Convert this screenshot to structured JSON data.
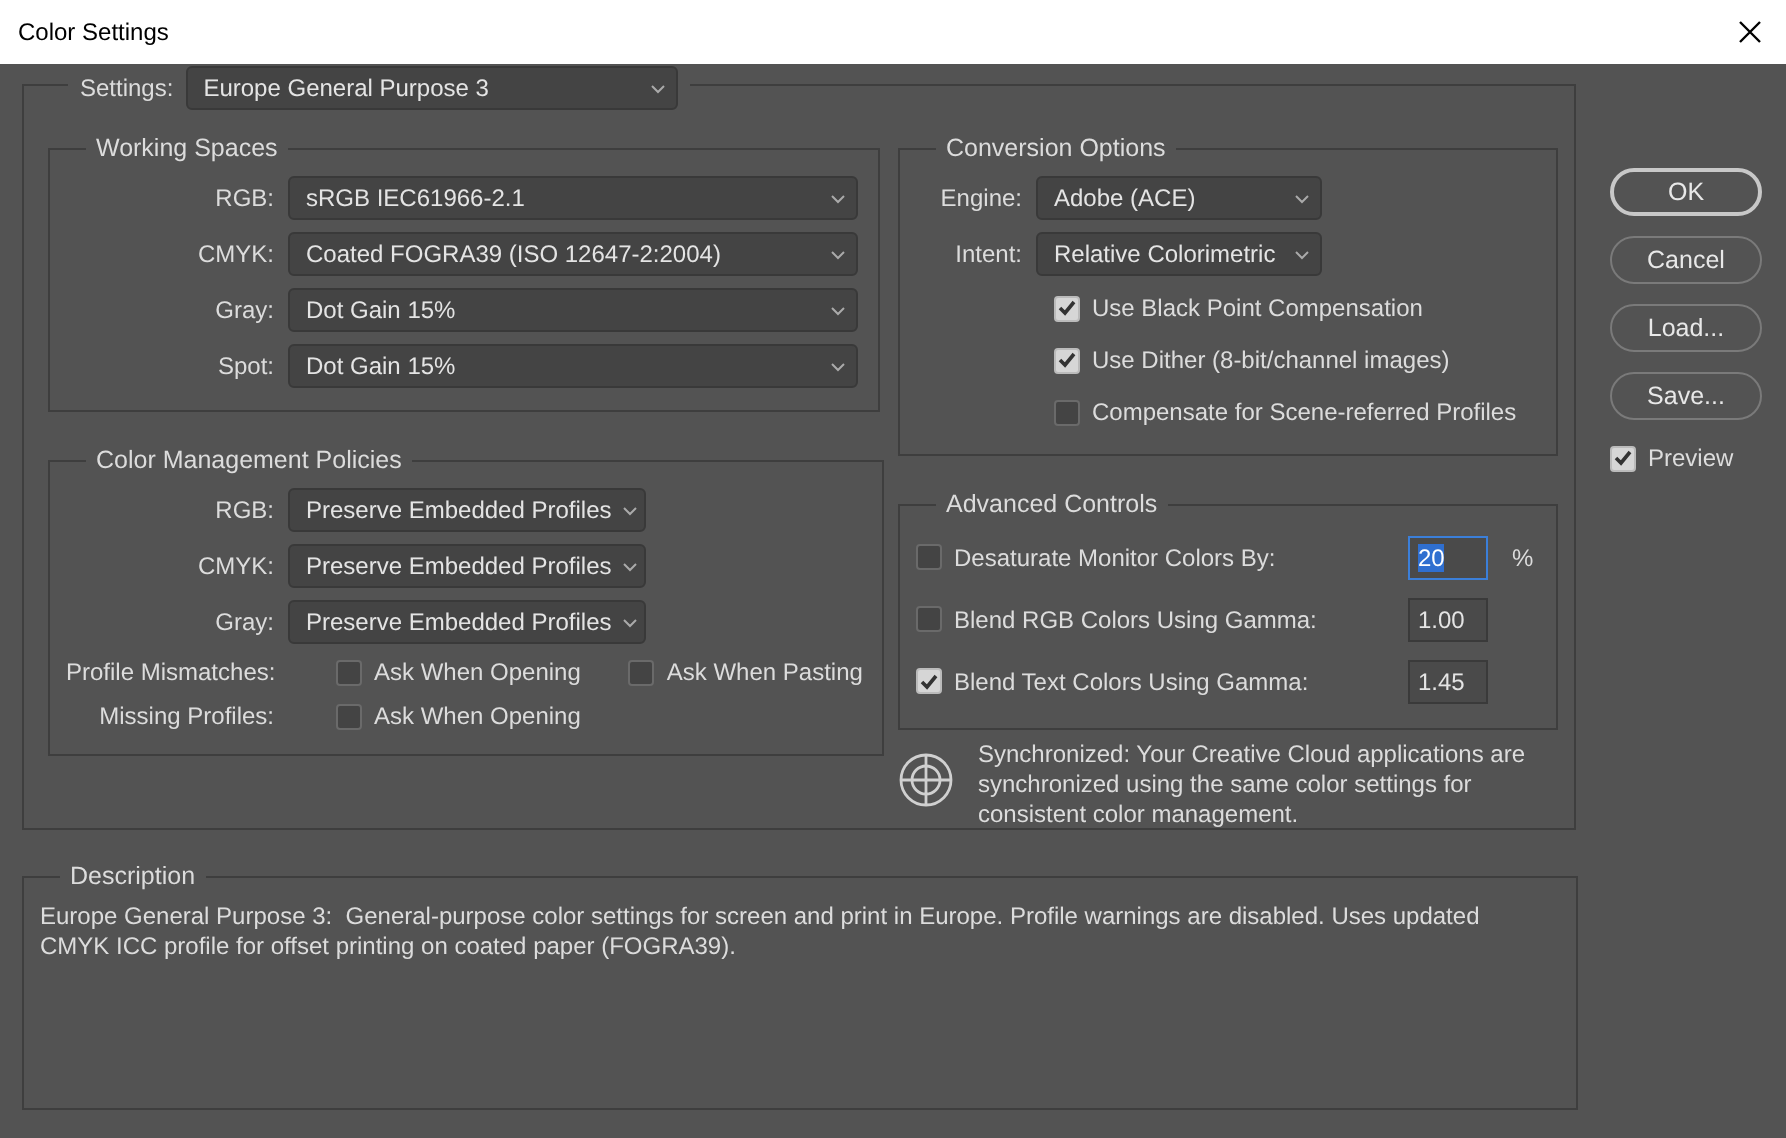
{
  "window": {
    "title": "Color Settings"
  },
  "settings": {
    "label": "Settings:",
    "value": "Europe General Purpose 3"
  },
  "working_spaces": {
    "title": "Working Spaces",
    "rows": [
      {
        "label": "RGB:",
        "value": "sRGB IEC61966-2.1"
      },
      {
        "label": "CMYK:",
        "value": "Coated FOGRA39 (ISO 12647-2:2004)"
      },
      {
        "label": "Gray:",
        "value": "Dot Gain 15%"
      },
      {
        "label": "Spot:",
        "value": "Dot Gain 15%"
      }
    ]
  },
  "policies": {
    "title": "Color Management Policies",
    "rows": [
      {
        "label": "RGB:",
        "value": "Preserve Embedded Profiles"
      },
      {
        "label": "CMYK:",
        "value": "Preserve Embedded Profiles"
      },
      {
        "label": "Gray:",
        "value": "Preserve Embedded Profiles"
      }
    ],
    "checks": [
      {
        "label": "Profile Mismatches:",
        "options": [
          {
            "label": "Ask When Opening",
            "checked": false
          },
          {
            "label": "Ask When Pasting",
            "checked": false
          }
        ]
      },
      {
        "label": "Missing Profiles:",
        "options": [
          {
            "label": "Ask When Opening",
            "checked": false
          }
        ]
      }
    ]
  },
  "conversion": {
    "title": "Conversion Options",
    "rows": [
      {
        "label": "Engine:",
        "value": "Adobe (ACE)"
      },
      {
        "label": "Intent:",
        "value": "Relative Colorimetric"
      }
    ],
    "options": [
      {
        "label": "Use Black Point Compensation",
        "checked": true
      },
      {
        "label": "Use Dither (8-bit/channel images)",
        "checked": true
      },
      {
        "label": "Compensate for Scene-referred Profiles",
        "checked": false
      }
    ]
  },
  "advanced": {
    "title": "Advanced Controls",
    "rows": [
      {
        "label": "Desaturate Monitor Colors By:",
        "checked": false,
        "value": "20",
        "unit": "%",
        "focused": true
      },
      {
        "label": "Blend RGB Colors Using Gamma:",
        "checked": false,
        "value": "1.00",
        "focused": false
      },
      {
        "label": "Blend Text Colors Using Gamma:",
        "checked": true,
        "value": "1.45",
        "focused": false
      }
    ]
  },
  "sync": {
    "text": "Synchronized: Your Creative Cloud applications are synchronized using the same color settings for consistent color management."
  },
  "buttons": [
    {
      "label": "OK",
      "default": true
    },
    {
      "label": "Cancel",
      "default": false
    },
    {
      "label": "Load...",
      "default": false
    },
    {
      "label": "Save...",
      "default": false
    }
  ],
  "preview": {
    "label": "Preview",
    "checked": true
  },
  "description": {
    "title": "Description",
    "text": "Europe General Purpose 3:  General-purpose color settings for screen and print in Europe. Profile warnings are disabled. Uses updated CMYK ICC profile for offset printing on coated paper (FOGRA39)."
  }
}
